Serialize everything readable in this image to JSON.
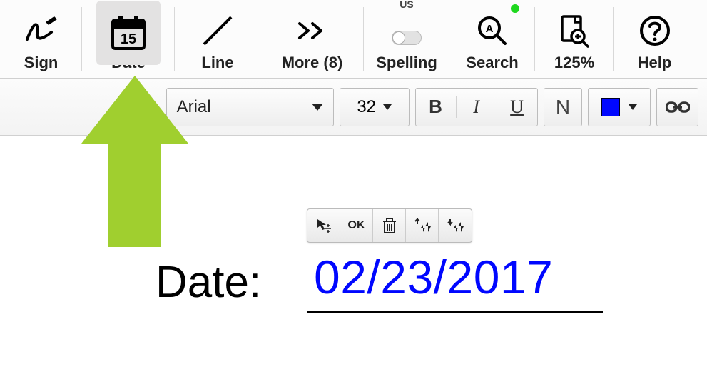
{
  "toolbar": {
    "sign_label": "Sign",
    "date_label": "Date",
    "line_label": "Line",
    "more_label": "More (8)",
    "spelling_label": "Spelling",
    "spelling_badge": "US",
    "search_label": "Search",
    "zoom_label": "125%",
    "help_label": "Help",
    "calendar_day": "15"
  },
  "format_bar": {
    "font_name": "Arial",
    "font_size": "32",
    "bold_label": "B",
    "italic_label": "I",
    "underline_label": "U",
    "normal_label": "N",
    "color_value": "#0007ff"
  },
  "float_toolbar": {
    "ok_label": "OK"
  },
  "document": {
    "field_label": "Date:",
    "field_value": "02/23/2017"
  },
  "annotation": {
    "arrow_color": "#a0cf2f"
  }
}
